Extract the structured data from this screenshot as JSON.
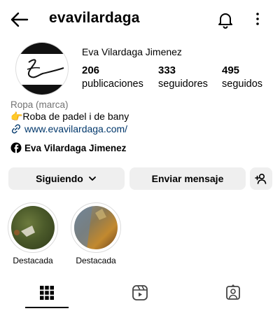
{
  "header": {
    "username": "evavilardaga",
    "icons": [
      "arrow-left-icon",
      "bell-icon",
      "more-vertical-icon"
    ]
  },
  "profile": {
    "full_name": "Eva Vilardaga Jimenez",
    "stats": [
      {
        "count": "206",
        "label": "publicaciones"
      },
      {
        "count": "333",
        "label": "seguidores"
      },
      {
        "count": "495",
        "label": "seguidos"
      }
    ],
    "category": "Ropa (marca)",
    "bio": "👉Roba de padel i de bany",
    "link": "www.evavilardaga.com/",
    "facebook_name": "Eva Vilardaga Jimenez"
  },
  "actions": {
    "following_label": "Siguiendo",
    "message_label": "Enviar mensaje"
  },
  "highlights": [
    {
      "label": "Destacada"
    },
    {
      "label": "Destacada"
    }
  ],
  "tabs": [
    "grid-icon",
    "reels-icon",
    "tagged-icon"
  ],
  "colors": {
    "link": "#00376b",
    "button_bg": "#efefef",
    "muted": "#737373"
  }
}
